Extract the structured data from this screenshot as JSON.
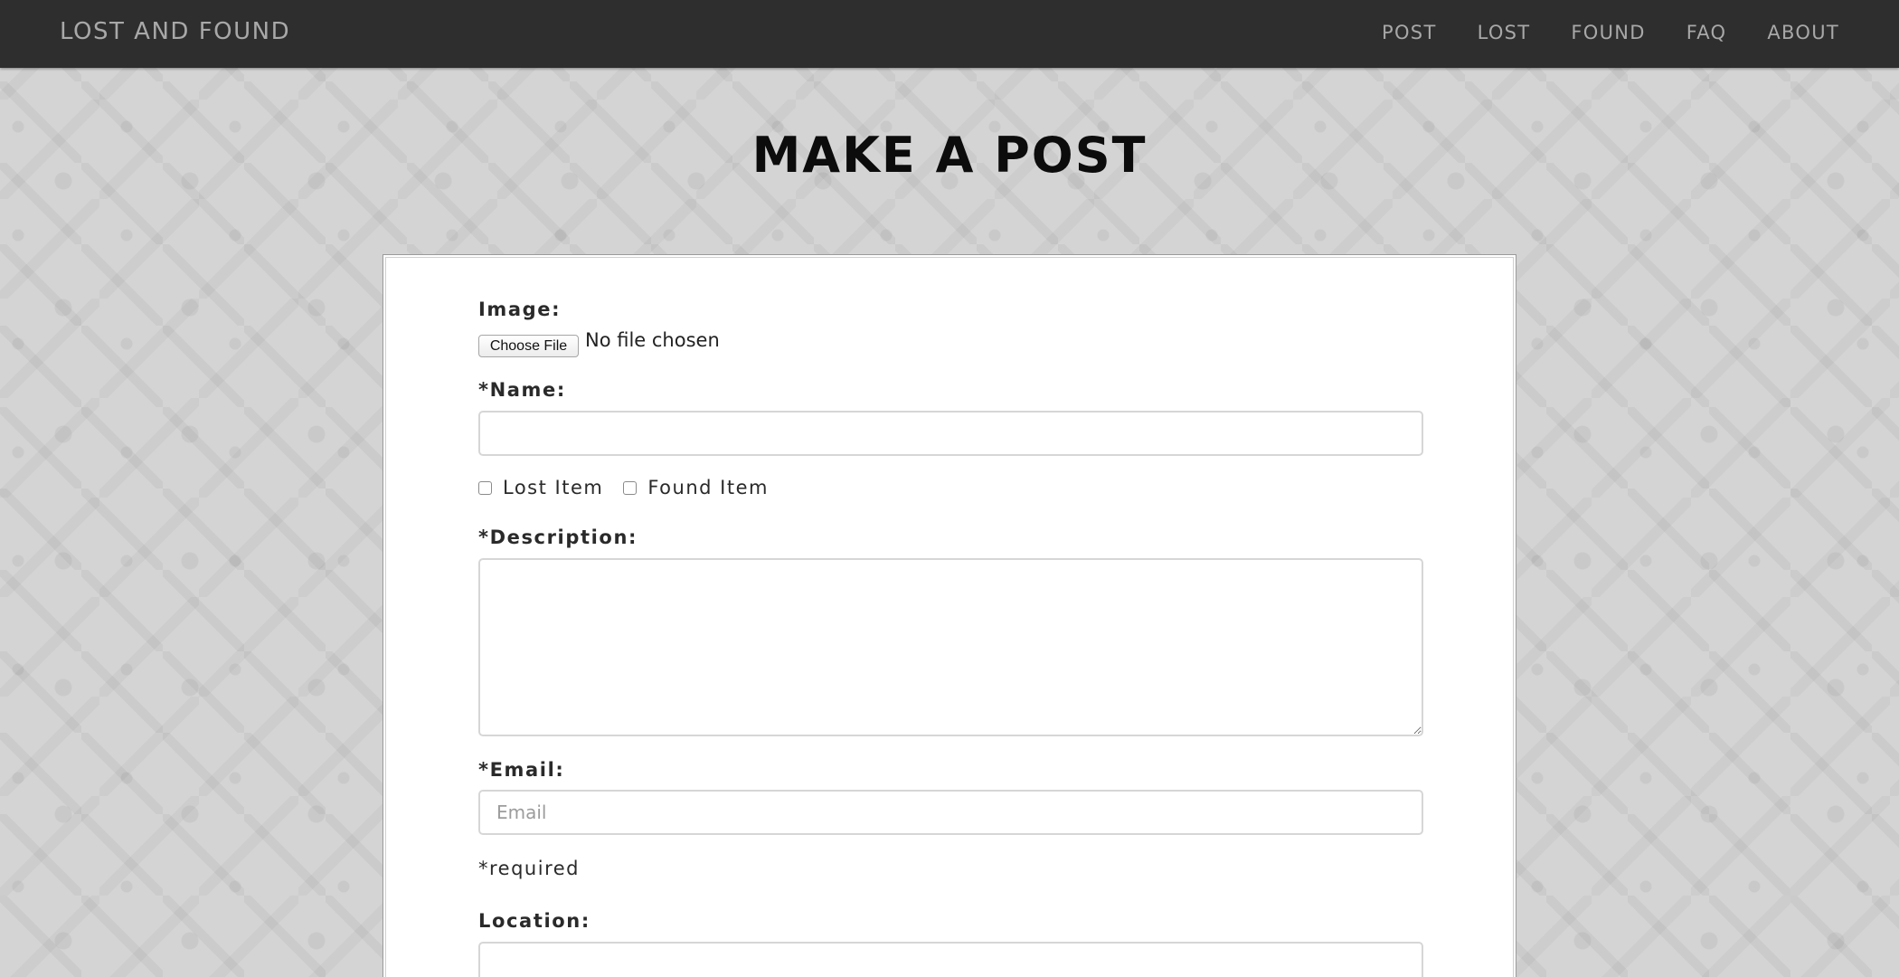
{
  "navbar": {
    "brand": "LOST AND FOUND",
    "links": [
      "POST",
      "LOST",
      "FOUND",
      "FAQ",
      "ABOUT"
    ]
  },
  "page": {
    "title": "MAKE A POST"
  },
  "form": {
    "image_label": "Image:",
    "file_button_label": "Choose File",
    "file_status": "No file chosen",
    "name_label": "*Name:",
    "name_value": "",
    "lost_item_label": "Lost Item",
    "lost_item_checked": false,
    "found_item_label": "Found Item",
    "found_item_checked": false,
    "description_label": "*Description:",
    "description_value": "",
    "email_label": "*Email:",
    "email_placeholder": "Email",
    "required_note": "*required",
    "location_label": "Location:",
    "location_value": ""
  },
  "colors": {
    "navbar_bg": "#2e2e2e",
    "navbar_text": "#a8a8a8",
    "page_bg": "#d4d4d4",
    "panel_bg": "#ffffff",
    "title_text": "#0c0c0c"
  }
}
